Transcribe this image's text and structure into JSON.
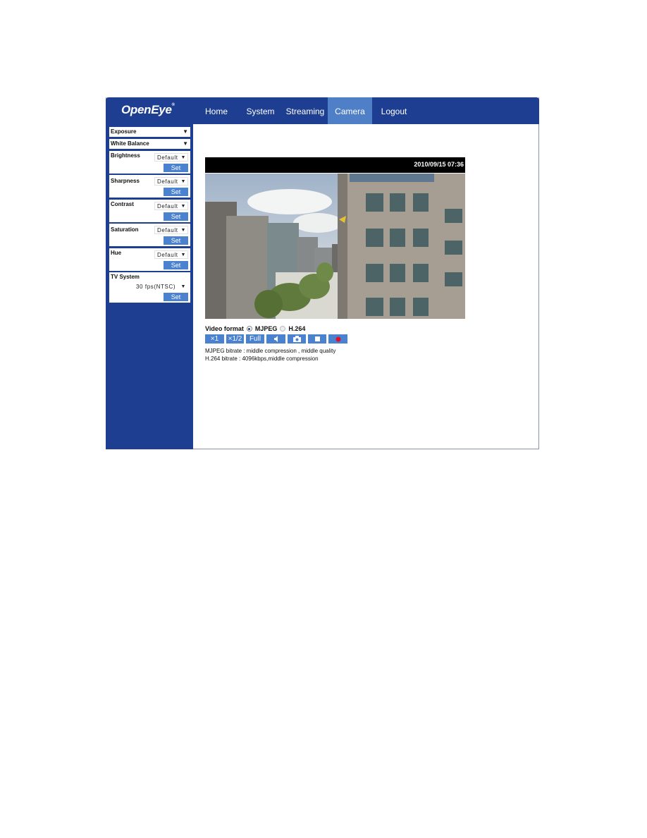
{
  "brand": {
    "name": "OpenEye",
    "mark": "®"
  },
  "nav": {
    "items": [
      {
        "label": "Home"
      },
      {
        "label": "System"
      },
      {
        "label": "Streaming"
      },
      {
        "label": "Camera",
        "active": true
      },
      {
        "label": "Logout"
      }
    ]
  },
  "sidebar": {
    "exposure": {
      "label": "Exposure"
    },
    "white_balance": {
      "label": "White Balance"
    },
    "brightness": {
      "label": "Brightness",
      "value": "Default",
      "set_label": "Set"
    },
    "sharpness": {
      "label": "Sharpness",
      "value": "Default",
      "set_label": "Set"
    },
    "contrast": {
      "label": "Contrast",
      "value": "Default",
      "set_label": "Set"
    },
    "saturation": {
      "label": "Saturation",
      "value": "Default",
      "set_label": "Set"
    },
    "hue": {
      "label": "Hue",
      "value": "Default",
      "set_label": "Set"
    },
    "tv_system": {
      "label": "TV System",
      "value": "30 fps(NTSC)",
      "set_label": "Set"
    }
  },
  "viewer": {
    "timestamp": "2010/09/15 07:36",
    "video_format_label": "Video format",
    "formats": [
      {
        "label": "MJPEG",
        "selected": true
      },
      {
        "label": "H.264",
        "selected": false
      }
    ],
    "controls": {
      "x1": "×1",
      "half": "×1/2",
      "full": "Full"
    },
    "mjpeg_info": "MJPEG bitrate : middle compression , middle quality",
    "h264_info": "H.264 bitrate : 4096kbps,middle compression"
  },
  "colors": {
    "brand_blue": "#1e3f91",
    "active_tab": "#4f7fc6",
    "button_blue": "#4a82cf",
    "record_red": "#e0102a"
  }
}
